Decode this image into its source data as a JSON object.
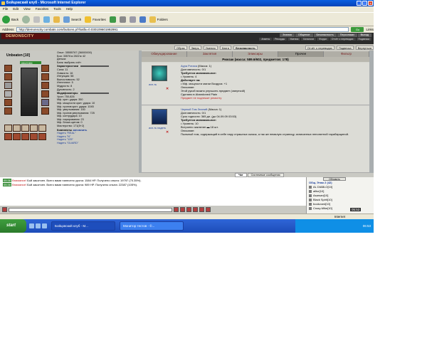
{
  "window": {
    "title": "Бойцовский клуб - Microsoft Internet Explorer",
    "buttons": [
      "_",
      "□",
      "×"
    ]
  },
  "menu": [
    "File",
    "Edit",
    "View",
    "Favorites",
    "Tools",
    "Help"
  ],
  "toolbar": {
    "back": "Back",
    "search": "Search",
    "favorites": "Favorites",
    "folders": "Folders"
  },
  "address": {
    "label": "Address",
    "url": "http://demonscity.combats.com/buttons.pl?batfa=0.030109601992991",
    "go": "Go",
    "links": "Links"
  },
  "game": {
    "logo": "DEMONSCITY",
    "top_menu": [
      "Знания",
      "Общение",
      "Безопасность",
      "Персонажи",
      "Выход"
    ],
    "top_menu2": [
      "Анкеты",
      "Рекорды",
      "Умения",
      "Каталоги",
      "Форум",
      "Отчёт о переводах",
      "Подвеска"
    ],
    "nav": [
      "Образ",
      "Зверь",
      "Умения",
      "Книги",
      "Безопасность",
      "Отчёт о переводах",
      "Подвеска",
      "Вернуться"
    ],
    "nav_active": "Безопасность"
  },
  "character": {
    "name": "Unbeaten",
    "level": "[10]",
    "hp": "1664/1664",
    "stats": [
      "Опыт: 35555767 (36000000)",
      "Бои: 33576 ▸ 2822 ▸ 42",
      "Деньги:",
      "Банк: выбрать счёт"
    ],
    "characteristics_title": "Характеристики",
    "characteristics": [
      "Сила: 11",
      "Ловкость: 16",
      "Интуиция: 58",
      "Выносливость: 52",
      "Интеллект: 5",
      "Мудрость: 8",
      "Духовность: 2"
    ],
    "modifiers_title": "Модификаторы",
    "modifiers": [
      "Урон: 750-826",
      "Мф. крит. удара: 350",
      "Мф. мощности крит. удара: 10",
      "Мф. против крит. удара: 1045",
      "Мф. увертывания: 150",
      "Мф. против увертывания: 725",
      "Мф. контрудара: 10",
      "Мф. парирования: 23",
      "Мф. блока щитом: 0",
      "Мастерство: 171(5+2)"
    ],
    "sets_title": "Комплекты",
    "sets_action": "запомнить",
    "sets": [
      "Надеть \"REAL\"",
      "Надеть \"N\"",
      "Надеть \"125\"",
      "Надеть \"GUARD\""
    ]
  },
  "inventory_tabs": [
    "Обмундирование",
    "Заклятия",
    "Эликсиры",
    "Прочее",
    "Фильтр"
  ],
  "inventory_active_tab": "Прочее",
  "inventory_header": "Рюкзак (масса: 589.6/602, предметов: 178)",
  "items": [
    {
      "name": "Аура Ротаха",
      "mass": "(Масса: 1)",
      "use": "исп-ть",
      "lines": [
        "Долговечность: 0/1",
        "Требуется минимальное:",
        "• Уровень: 4",
        "Действует на:",
        "• Мф. мощности магии Воздуха: +1",
        "Описание:",
        "Этой рукой можно улучшить предмет (смерткой)",
        "Сделано в Abandoned Plain"
      ],
      "note": "Предмет не подлежит ремонту"
    },
    {
      "name": "Черный Том Знаний",
      "mass": "(Масса: 1)",
      "use": "исп-ть",
      "wear": "надеть",
      "lines": [
        "Долговечность: 0/1",
        "Срок годности: 365 дн. (до 04.09.09 03:53)",
        "Требуется минимальное:",
        "• Уровень: 10",
        "Встроено заклятие ▬ 18 шт.",
        "Описание:",
        "Пыльный том, содержащий в себе пару страшных сказок, а так же немалую страницу, исписанных непонятной тарабарщиной."
      ]
    }
  ],
  "chat": {
    "tabs": [
      "Чат",
      "Системные сообщения"
    ],
    "lines": [
      {
        "time": "05:36",
        "warn": "Внимание!",
        "text": "Бой закончен. Всего вами нанесено урона: 1584 HP. Получено опыта: 19797 (70.35%)."
      },
      {
        "time": "05:36",
        "warn": "Внимание!",
        "text": "Бой закончен. Всего вами нанесено урона: 989 HP. Получено опыта: 22387 (105%)."
      }
    ]
  },
  "players": {
    "refresh": "Обновить",
    "title": "Общ. Этаж 2 (42)",
    "list": [
      "AL DIABLO[10]",
      "alltor[10]",
      "Asarsan[10]",
      "Black Spirit[10]",
      "bookvoed[10]",
      "Crazy-Mike[10]"
    ]
  },
  "clock": "05:53",
  "status": {
    "left": "",
    "zone": "Internet"
  },
  "taskbar": {
    "start": "start",
    "tasks": [
      "Бойцовский клуб - M...",
      "Монитор тестов - ©..."
    ],
    "time": "06:53"
  }
}
